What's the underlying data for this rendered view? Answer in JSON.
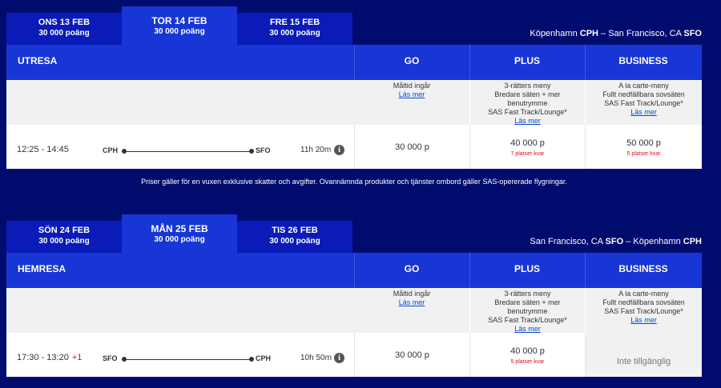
{
  "outbound": {
    "tabs": [
      {
        "date": "ONS 13 FEB",
        "points": "30 000 poäng"
      },
      {
        "date": "TOR 14 FEB",
        "points": "30 000 poäng"
      },
      {
        "date": "FRE 15 FEB",
        "points": "30 000 poäng"
      }
    ],
    "route": {
      "from_city": "Köpenhamn",
      "from_code": "CPH",
      "sep": " – ",
      "to_city": "San Francisco, CA",
      "to_code": "SFO"
    },
    "direction": "UTRESA",
    "columns": {
      "go": "GO",
      "plus": "PLUS",
      "business": "BUSINESS"
    },
    "descriptions": {
      "go": {
        "lines": [
          "Måltid ingår"
        ],
        "link": "Läs mer"
      },
      "plus": {
        "lines": [
          "3-rätters meny",
          "Bredare säten + mer",
          "benutrymme",
          "SAS Fast Track/Lounge*"
        ],
        "link": "Läs mer"
      },
      "business": {
        "lines": [
          "A la carte-meny",
          "Fullt nedfällbara sovsäten",
          "SAS Fast Track/Lounge*"
        ],
        "link": "Läs mer"
      }
    },
    "flight": {
      "time": "12:25 - 14:45",
      "plus_day": "",
      "from": "CPH",
      "to": "SFO",
      "duration": "11h 20m",
      "go_price": "30 000 p",
      "plus_price": "40 000 p",
      "plus_seats": "7 platser kvar",
      "business_price": "50 000 p",
      "business_seats": "5 platser kvar"
    }
  },
  "note": "Priser gäller för en vuxen exklusive skatter och avgifter. Ovannämnda produkter och tjänster ombord gäller SAS-opererade flygningar.",
  "inbound": {
    "tabs": [
      {
        "date": "SÖN 24 FEB",
        "points": "30 000 poäng"
      },
      {
        "date": "MÅN 25 FEB",
        "points": "30 000 poäng"
      },
      {
        "date": "TIS 26 FEB",
        "points": "30 000 poäng"
      }
    ],
    "route": {
      "from_city": "San Francisco, CA",
      "from_code": "SFO",
      "sep": " – ",
      "to_city": "Köpenhamn",
      "to_code": "CPH"
    },
    "direction": "HEMRESA",
    "columns": {
      "go": "GO",
      "plus": "PLUS",
      "business": "BUSINESS"
    },
    "descriptions": {
      "go": {
        "lines": [
          "Måltid ingår"
        ],
        "link": "Läs mer"
      },
      "plus": {
        "lines": [
          "3-rätters meny",
          "Bredare säten + mer",
          "benutrymme",
          "SAS Fast Track/Lounge*"
        ],
        "link": "Läs mer"
      },
      "business": {
        "lines": [
          "A la carte-meny",
          "Fullt nedfällbara sovsäten",
          "SAS Fast Track/Lounge*"
        ],
        "link": "Läs mer"
      }
    },
    "flight": {
      "time": "17:30 - 13:20",
      "plus_day": "+1",
      "from": "SFO",
      "to": "CPH",
      "duration": "10h 50m",
      "go_price": "30 000 p",
      "plus_price": "40 000 p",
      "plus_seats": "5 platser kvar",
      "business_unavailable": "Inte tillgänglig"
    }
  },
  "icons": {
    "info": "info-icon"
  },
  "colors": {
    "background": "#000b6e",
    "header": "#1836d6",
    "tab": "#0a1bb8",
    "link": "#0b46d8",
    "alert": "#e0101c"
  }
}
